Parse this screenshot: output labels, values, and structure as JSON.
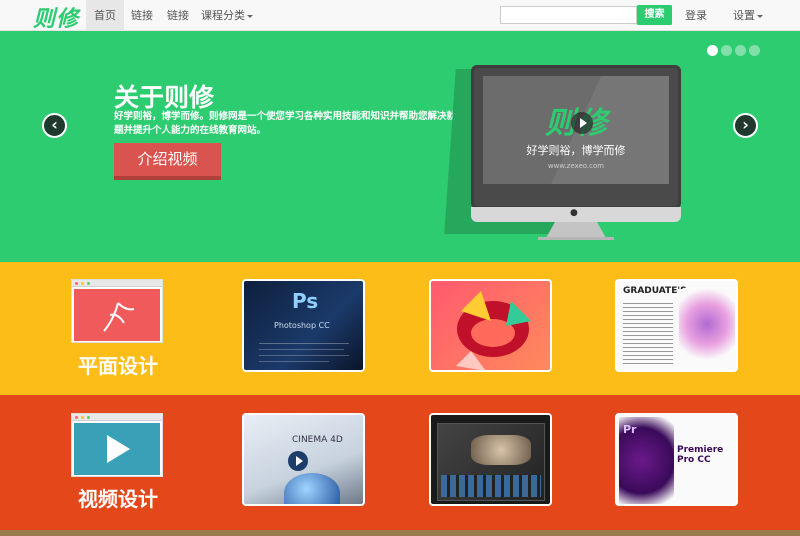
{
  "navbar": {
    "brand": "则修",
    "items": [
      {
        "label": "首页",
        "active": true
      },
      {
        "label": "链接",
        "active": false
      },
      {
        "label": "链接",
        "active": false
      },
      {
        "label": "课程分类",
        "active": false,
        "dropdown": true
      }
    ],
    "search": {
      "placeholder": "",
      "value": "",
      "button": "搜索"
    },
    "login": "登录",
    "settings": "设置"
  },
  "carousel": {
    "title": "关于则修",
    "description": "好学则裕，博学而修。则修网是一个使您学习各种实用技能和知识并帮助您解决就业问题并提升个人能力的在线教育网站。",
    "button": "介绍视频",
    "prev": "‹",
    "next": "›",
    "slide_count": 4,
    "active_slide": 1,
    "screen": {
      "logo": "则修",
      "tagline": "好学则裕，博学而修",
      "url": "www.zexeo.com"
    }
  },
  "categories": [
    {
      "label": "平面设计",
      "color": "#fdbd18",
      "thumbs": [
        {
          "name": "photoshop-cc-thumb",
          "title": "Ps",
          "subtitle": "Photoshop CC"
        },
        {
          "name": "adobe-cc-thumb",
          "title": "",
          "subtitle": ""
        },
        {
          "name": "magazine-layout-thumb",
          "title": "GRADUATE'S",
          "subtitle": ""
        }
      ]
    },
    {
      "label": "视频设计",
      "color": "#e4471a",
      "thumbs": [
        {
          "name": "cinema4d-thumb",
          "title": "CINEMA 4D",
          "subtitle": ""
        },
        {
          "name": "video-editing-thumb",
          "title": "",
          "subtitle": ""
        },
        {
          "name": "premiere-pro-thumb",
          "title": "Pr",
          "subtitle": "Premiere Pro CC"
        }
      ]
    }
  ],
  "colors": {
    "green": "#2ecc71",
    "yellow": "#fdbd18",
    "orange": "#e4471a",
    "red_button": "#d9534f"
  }
}
